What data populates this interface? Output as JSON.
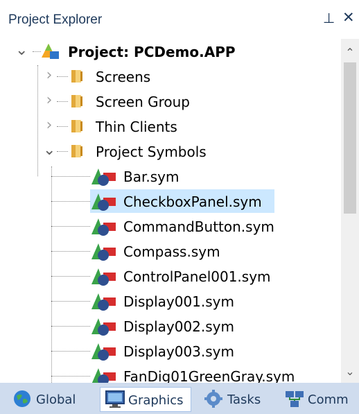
{
  "panel": {
    "title": "Project Explorer",
    "pin_glyph": "⊥",
    "close_glyph": "✕"
  },
  "tree": {
    "root": {
      "label": "Project: PCDemo.APP",
      "expanded": true,
      "icon": "project-icon"
    },
    "folders": [
      {
        "label": "Screens",
        "expanded": false,
        "icon": "folder-icon"
      },
      {
        "label": "Screen Group",
        "expanded": false,
        "icon": "folder-icon"
      },
      {
        "label": "Thin Clients",
        "expanded": false,
        "icon": "folder-icon"
      },
      {
        "label": "Project Symbols",
        "expanded": true,
        "icon": "folder-icon"
      }
    ],
    "symbols": [
      {
        "label": "Bar.sym",
        "selected": false,
        "icon": "symbol-icon"
      },
      {
        "label": "CheckboxPanel.sym",
        "selected": true,
        "icon": "symbol-icon"
      },
      {
        "label": "CommandButton.sym",
        "selected": false,
        "icon": "symbol-icon"
      },
      {
        "label": "Compass.sym",
        "selected": false,
        "icon": "symbol-icon"
      },
      {
        "label": "ControlPanel001.sym",
        "selected": false,
        "icon": "symbol-icon"
      },
      {
        "label": "Display001.sym",
        "selected": false,
        "icon": "symbol-icon"
      },
      {
        "label": "Display002.sym",
        "selected": false,
        "icon": "symbol-icon"
      },
      {
        "label": "Display003.sym",
        "selected": false,
        "icon": "symbol-icon"
      },
      {
        "label": "FanDig01GreenGray.sym",
        "selected": false,
        "icon": "symbol-icon"
      }
    ]
  },
  "tabs": [
    {
      "label": "Global",
      "icon": "globe-icon",
      "active": false
    },
    {
      "label": "Graphics",
      "icon": "monitor-icon",
      "active": true
    },
    {
      "label": "Tasks",
      "icon": "gear-icon",
      "active": false
    },
    {
      "label": "Comm",
      "icon": "network-icon",
      "active": false
    }
  ],
  "colors": {
    "selection": "#cce8ff",
    "tabbar": "#cfdcee",
    "title_text": "#1e395b"
  }
}
